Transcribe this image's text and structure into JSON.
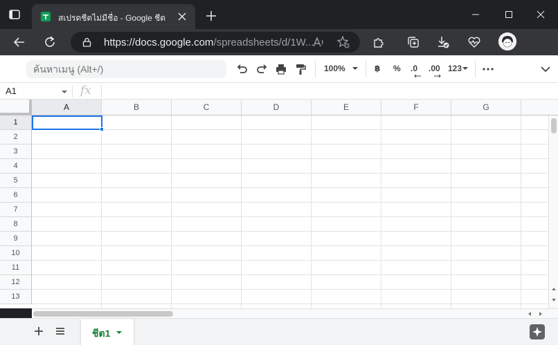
{
  "browser": {
    "tab_title": "สเปรดชีตไม่มีชื่อ - Google ชีต",
    "url_host": "https://docs.google.com",
    "url_path": "/spreadsheets/d/1W..."
  },
  "toolbar": {
    "menu_search_placeholder": "ค้นหาเมนู (Alt+/)",
    "zoom": "100%",
    "currency_label": "฿",
    "percent_label": "%",
    "decrease_decimal_label": ".0",
    "increase_decimal_label": ".00",
    "number_format_label": "123"
  },
  "formula_bar": {
    "name_box": "A1",
    "fx_label": "fx",
    "formula": ""
  },
  "grid": {
    "columns": [
      "A",
      "B",
      "C",
      "D",
      "E",
      "F",
      "G"
    ],
    "rows": [
      "1",
      "2",
      "3",
      "4",
      "5",
      "6",
      "7",
      "8",
      "9",
      "10",
      "11",
      "12",
      "13"
    ],
    "selected_cell": "A1"
  },
  "sheets": {
    "active_sheet": "ชีต1"
  },
  "colors": {
    "accent": "#1a73e8",
    "sheets_green": "#188038",
    "chrome_dark": "#202124"
  }
}
